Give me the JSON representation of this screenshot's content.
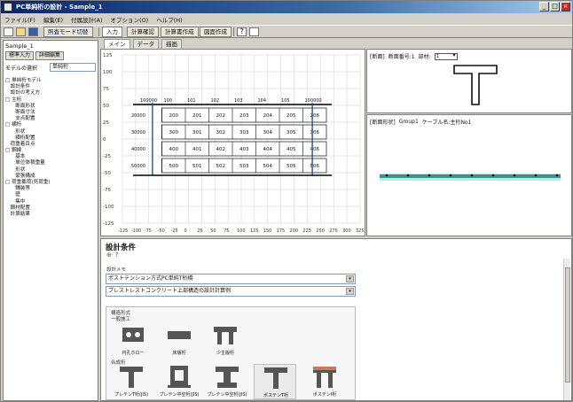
{
  "window": {
    "title": "PC単純桁の設計 - Sample_1"
  },
  "menu": [
    "ファイル(F)",
    "編集(E)",
    "付属設計(A)",
    "オプション(O)",
    "ヘルプ(H)"
  ],
  "toolbar": {
    "mode_label": "照査モード切替",
    "buttons": [
      "入力",
      "計算確認",
      "計算書作成",
      "図面作成"
    ]
  },
  "left": {
    "project": "Sample_1",
    "tabs": [
      "標準入力",
      "詳細編集"
    ],
    "model_select_label": "モデルの選択",
    "model_select_value": "単純桁",
    "tree": [
      "□ 単純桁モデル",
      "　設計条件",
      "　設計の考え方",
      "□ 主桁",
      "　　断面形状",
      "　　断面寸法",
      "　　支点配置",
      "□ 横桁",
      "　　形状",
      "　　横桁配置",
      "　荷重着目点",
      "□ 鋼線",
      "　　基本",
      "　　単位体積重量",
      "　　形状",
      "　　緊張構成",
      "□ 荷重載荷(死荷重)",
      "　　舗装等",
      "　　壁",
      "　　集中",
      "　鋼材配置",
      "　計算結果"
    ]
  },
  "main_tabs": [
    "メイン",
    "データ",
    "描画"
  ],
  "section_view": {
    "y_ticks": [
      "125",
      "100",
      "75",
      "50",
      "25",
      "0",
      "-25",
      "-50",
      "-75",
      "-100",
      "-125"
    ],
    "x_ticks": [
      "-125",
      "-100",
      "-75",
      "-50",
      "-25",
      "0",
      "25",
      "50",
      "75",
      "100",
      "125",
      "150",
      "175",
      "200",
      "225",
      "250",
      "275",
      "300",
      "325"
    ],
    "header_labels": [
      "100000",
      "100",
      "101",
      "102",
      "103",
      "104",
      "105",
      "100000"
    ],
    "rows": [
      {
        "left": "20000",
        "cells": [
          "200",
          "201",
          "202",
          "203",
          "204",
          "205",
          "206"
        ]
      },
      {
        "left": "30000",
        "cells": [
          "300",
          "301",
          "302",
          "303",
          "304",
          "305",
          "306"
        ]
      },
      {
        "left": "40000",
        "cells": [
          "400",
          "401",
          "402",
          "403",
          "404",
          "405",
          "406"
        ]
      },
      {
        "left": "50000",
        "cells": [
          "500",
          "501",
          "502",
          "503",
          "504",
          "505",
          "506"
        ]
      }
    ]
  },
  "section_panel": {
    "title": "[断面]",
    "label": "断面番号:1",
    "part_label": "部材:",
    "part_value": "1"
  },
  "cable_panel": {
    "title": "[断面形状]",
    "group": "Group1",
    "cable": "ケーブル名:主桁No1"
  },
  "design": {
    "title": "設計条件",
    "memo_label": "設計メモ",
    "memo_text": "ポストテンション方式PC単純T桁橋",
    "memo_text2": "プレストレストコンクリート上部構造の設計計算例",
    "structure_label": "構造形式",
    "group1_label": "一般施工",
    "group1": [
      "円孔ホロー",
      "床版桁",
      "少主版桁"
    ],
    "group2_label": "合成桁",
    "group2": [
      "プレテンT桁(JIS)",
      "プレテン中空桁(JIS)",
      "プレテン中空桁(JIS)",
      "ポステンT桁",
      "ポステンI桁"
    ]
  },
  "colors": {
    "accent": "#0a246a",
    "cable": "#20a0a0",
    "grid": "#cfcfcf"
  }
}
